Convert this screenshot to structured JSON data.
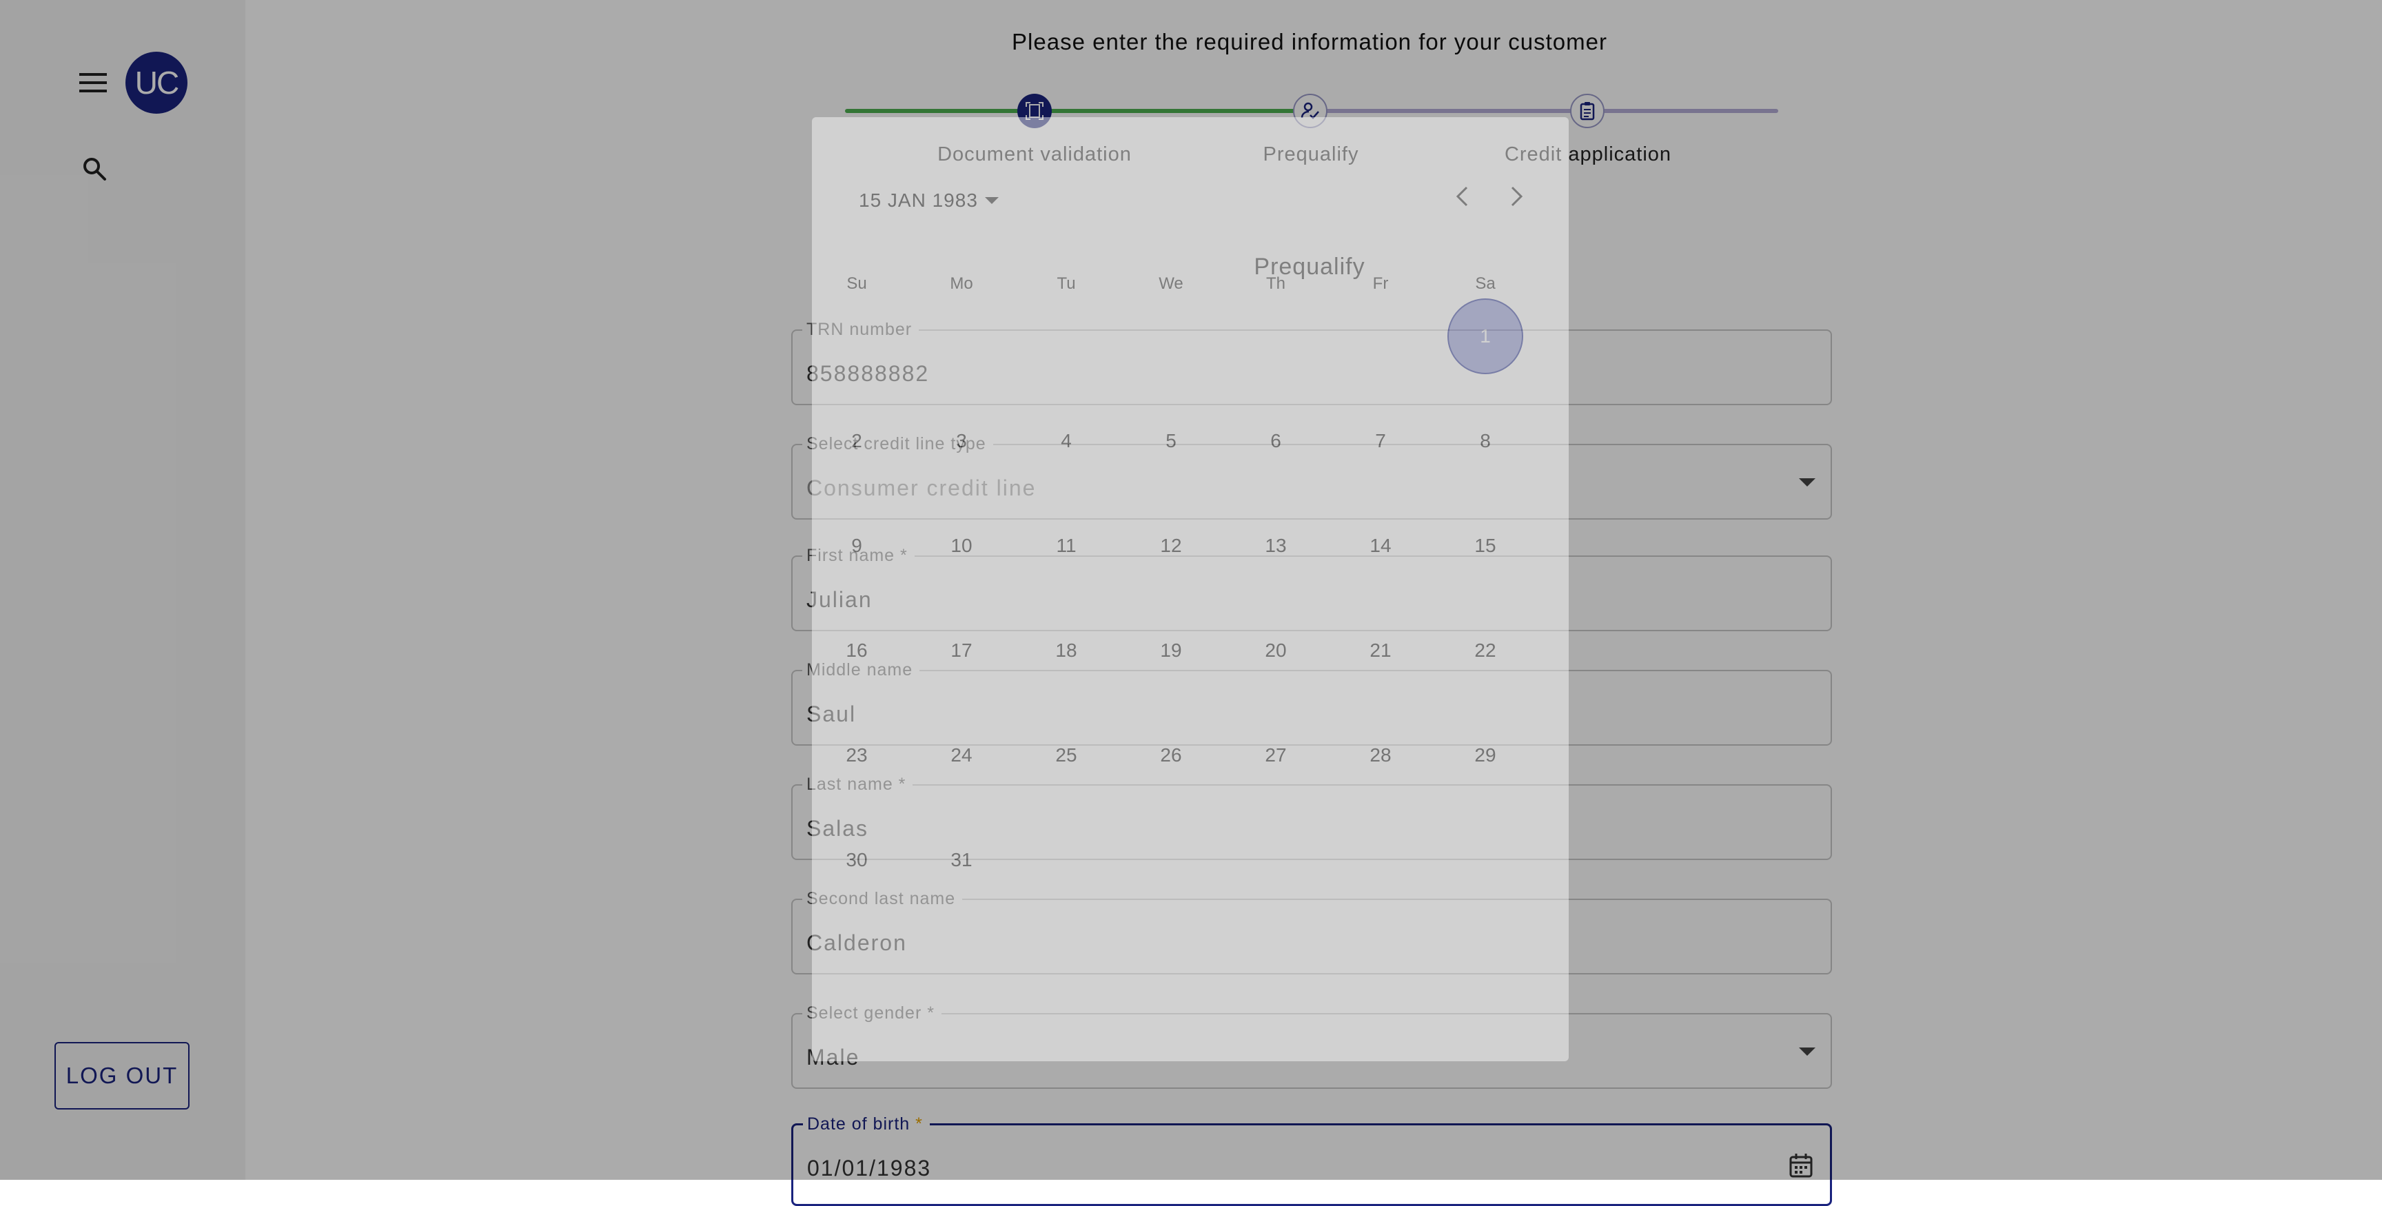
{
  "sidebar": {
    "avatar_initials": "UC",
    "logout_label": "LOG OUT",
    "icons": [
      "menu-icon",
      "search-icon"
    ]
  },
  "header": {
    "instruction": "Please enter the required information for your customer"
  },
  "stepper": {
    "steps": [
      {
        "label": "Document validation",
        "icon": "document-scan-icon",
        "state": "active"
      },
      {
        "label": "Prequalify",
        "icon": "person-check-icon",
        "state": "current"
      },
      {
        "label": "Credit application",
        "icon": "clipboard-icon",
        "state": "upcoming"
      }
    ],
    "colors": {
      "completed": "#4caf50",
      "pending": "#b3acd6",
      "active_circle": "#1a237e"
    }
  },
  "form": {
    "section_title": "Prequalify",
    "fields": [
      {
        "label": "TRN number",
        "value": "858888882"
      },
      {
        "label": "Select credit line type",
        "value": "Consumer credit line"
      },
      {
        "label": "First name *",
        "value": "Julian"
      },
      {
        "label": "Middle name",
        "value": "Saul"
      },
      {
        "label": "Last name *",
        "value": "Salas"
      },
      {
        "label": "Second last name",
        "value": "Calderon"
      },
      {
        "label": "Select gender *",
        "value": "Male"
      },
      {
        "label": "Date of birth",
        "required_mark": "*",
        "value": "01/01/1983"
      }
    ]
  },
  "datepicker": {
    "current_month_label": "15 JAN 1983",
    "weekdays": [
      "Su",
      "Mo",
      "Tu",
      "We",
      "Th",
      "Fr",
      "Sa"
    ],
    "days": [
      "1",
      "2",
      "3",
      "4",
      "5",
      "6",
      "7",
      "8",
      "9",
      "10",
      "11",
      "12",
      "13",
      "14",
      "15",
      "16",
      "17",
      "18",
      "19",
      "20",
      "21",
      "22",
      "23",
      "24",
      "25",
      "26",
      "27",
      "28",
      "29",
      "30",
      "31"
    ],
    "selected_day": "1",
    "accent_color": "#3c46a0"
  }
}
